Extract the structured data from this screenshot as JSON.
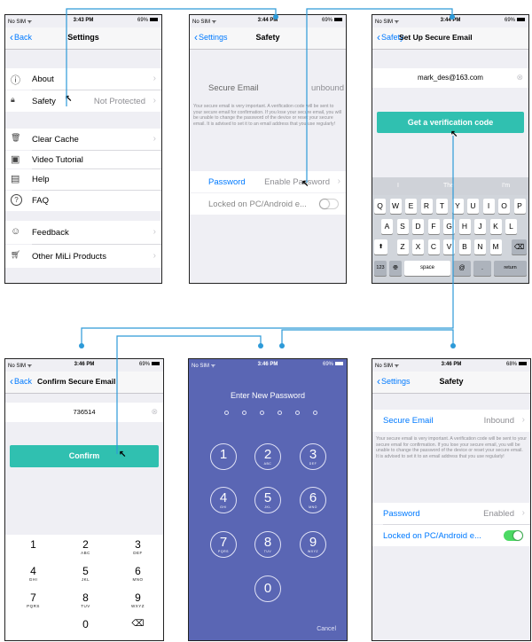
{
  "colors": {
    "accent": "#007aff",
    "teal": "#30c0b0",
    "connector": "#2d9ad8",
    "toggle_on": "#4cd964",
    "pad_bg": "#5a66b4"
  },
  "status": {
    "s1": {
      "carrier": "No SIM ᯤ",
      "time": "3:43 PM",
      "battery": "69%"
    },
    "s2": {
      "carrier": "No SIM ᯤ",
      "time": "3:44 PM",
      "battery": "69%"
    },
    "s3": {
      "carrier": "No SIM ᯤ",
      "time": "3:44 PM",
      "battery": "69%"
    },
    "s4": {
      "carrier": "No SIM ᯤ",
      "time": "3:46 PM",
      "battery": "69%"
    },
    "s5": {
      "carrier": "No SIM ᯤ",
      "time": "3:46 PM",
      "battery": "69%"
    },
    "s6": {
      "carrier": "No SIM ᯤ",
      "time": "3:46 PM",
      "battery": "68%"
    }
  },
  "settings": {
    "back": "Back",
    "title": "Settings",
    "items": [
      {
        "icon": "info-icon",
        "glyph": "ⓘ",
        "label": "About"
      },
      {
        "icon": "lock-icon",
        "glyph": "🔒︎",
        "label": "Safety",
        "value": "Not Protected"
      },
      {
        "icon": "trash-icon",
        "glyph": "🗑︎",
        "label": "Clear Cache"
      },
      {
        "icon": "video-icon",
        "glyph": "▣",
        "label": "Video Tutorial"
      },
      {
        "icon": "document-icon",
        "glyph": "▤",
        "label": "Help"
      },
      {
        "icon": "question-icon",
        "glyph": "?",
        "label": "FAQ"
      },
      {
        "icon": "people-icon",
        "glyph": "☺",
        "label": "Feedback"
      },
      {
        "icon": "cart-icon",
        "glyph": "🛒︎",
        "label": "Other MiLi Products"
      }
    ]
  },
  "safety1": {
    "back": "Settings",
    "title": "Safety",
    "email_label": "Secure Email",
    "email_value": "unbound",
    "note": "Your secure email is very important. A verification code will be sent to your secure email for confirmation. If you lose your secure email, you will be unable to change the password of the device or reset your secure email. It is advised to set it to an email address that you use regularly!",
    "password_label": "Password",
    "password_value": "Enable Password",
    "locked_label": "Locked on PC/Android e...",
    "locked_on": false
  },
  "setup_email": {
    "back": "Safety",
    "title": "Set Up Secure Email",
    "email": "mark_des@163.com",
    "button": "Get a verification code",
    "suggestions": [
      "I",
      "The",
      "I'm"
    ],
    "row1": [
      "Q",
      "W",
      "E",
      "R",
      "T",
      "Y",
      "U",
      "I",
      "O",
      "P"
    ],
    "row2": [
      "A",
      "S",
      "D",
      "F",
      "G",
      "H",
      "J",
      "K",
      "L"
    ],
    "row3": [
      "Z",
      "X",
      "C",
      "V",
      "B",
      "N",
      "M"
    ],
    "shift": "⬆",
    "delete": "⌫",
    "num": "123",
    "globe": "🌐︎",
    "space": "space",
    "at": "@",
    "dot": ".",
    "return": "return"
  },
  "confirm_email": {
    "back": "Back",
    "title": "Confirm Secure Email",
    "code": "736514",
    "button": "Confirm",
    "keys": [
      {
        "d": "1",
        "s": ""
      },
      {
        "d": "2",
        "s": "ABC"
      },
      {
        "d": "3",
        "s": "DEF"
      },
      {
        "d": "4",
        "s": "GHI"
      },
      {
        "d": "5",
        "s": "JKL"
      },
      {
        "d": "6",
        "s": "MNO"
      },
      {
        "d": "7",
        "s": "PQRS"
      },
      {
        "d": "8",
        "s": "TUV"
      },
      {
        "d": "9",
        "s": "WXYZ"
      },
      {
        "d": "0",
        "s": ""
      }
    ],
    "delete": "⌫"
  },
  "new_password": {
    "title": "Enter New Password",
    "keys": [
      {
        "d": "1",
        "s": ""
      },
      {
        "d": "2",
        "s": "ABC"
      },
      {
        "d": "3",
        "s": "DEF"
      },
      {
        "d": "4",
        "s": "GHI"
      },
      {
        "d": "5",
        "s": "JKL"
      },
      {
        "d": "6",
        "s": "MNO"
      },
      {
        "d": "7",
        "s": "PQRS"
      },
      {
        "d": "8",
        "s": "TUV"
      },
      {
        "d": "9",
        "s": "WXYZ"
      },
      {
        "d": "0",
        "s": ""
      }
    ],
    "cancel": "Cancel"
  },
  "safety2": {
    "back": "Settings",
    "title": "Safety",
    "email_label": "Secure Email",
    "email_value": "Inbound",
    "note": "Your secure email is very important. A verification code will be sent to your secure email for confirmation. If you lose your secure email, you will be unable to change the password of the device or reset your secure email. It is advised to set it to an email address that you use regularly!",
    "password_label": "Password",
    "password_value": "Enabled",
    "locked_label": "Locked on PC/Android e...",
    "locked_on": true
  },
  "glyphs": {
    "chevron": "›",
    "back_chevron": "‹",
    "pointer": "↖",
    "clear": "⊗"
  }
}
